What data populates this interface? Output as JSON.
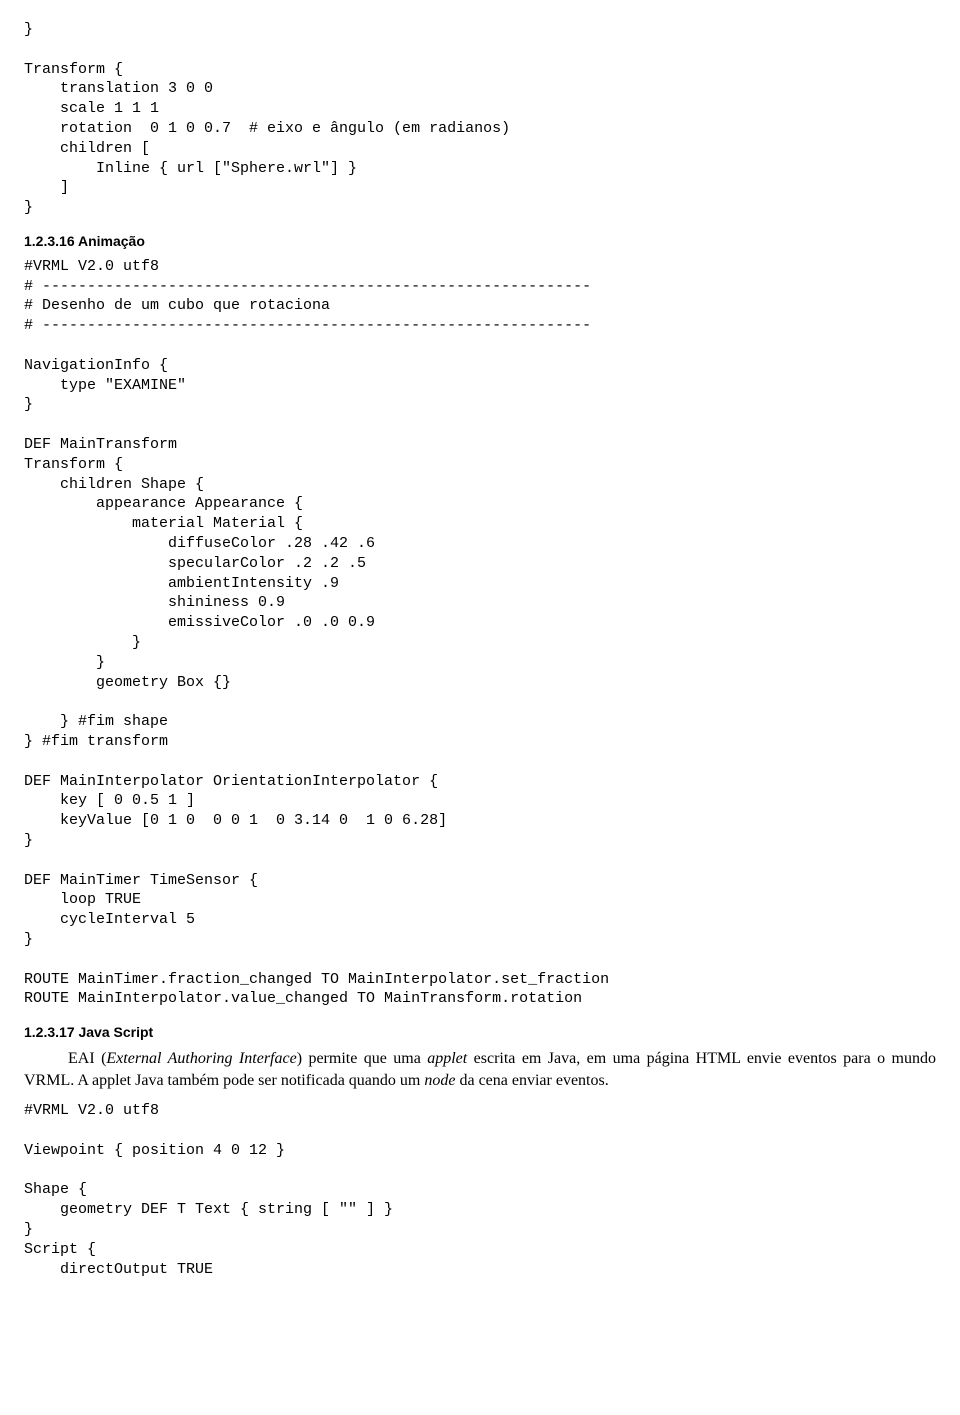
{
  "code_block_1": "}\n\nTransform {\n    translation 3 0 0\n    scale 1 1 1\n    rotation  0 1 0 0.7  # eixo e ângulo (em radianos)\n    children [\n        Inline { url [\"Sphere.wrl\"] }\n    ]\n}",
  "heading_1": "1.2.3.16  Animação",
  "code_block_2": "#VRML V2.0 utf8\n# -------------------------------------------------------------\n# Desenho de um cubo que rotaciona\n# -------------------------------------------------------------\n\nNavigationInfo {\n    type \"EXAMINE\"\n}\n\nDEF MainTransform\nTransform {\n    children Shape {\n        appearance Appearance {\n            material Material {\n                diffuseColor .28 .42 .6\n                specularColor .2 .2 .5\n                ambientIntensity .9\n                shininess 0.9\n                emissiveColor .0 .0 0.9\n            }\n        }\n        geometry Box {}\n\n    } #fim shape\n} #fim transform\n\nDEF MainInterpolator OrientationInterpolator {\n    key [ 0 0.5 1 ]\n    keyValue [0 1 0  0 0 1  0 3.14 0  1 0 6.28]\n}\n\nDEF MainTimer TimeSensor {\n    loop TRUE\n    cycleInterval 5\n}\n\nROUTE MainTimer.fraction_changed TO MainInterpolator.set_fraction\nROUTE MainInterpolator.value_changed TO MainTransform.rotation",
  "heading_2": "1.2.3.17  Java Script",
  "paragraph_1_a": "EAI (",
  "paragraph_1_b": "External Authoring Interface",
  "paragraph_1_c": ") permite que uma ",
  "paragraph_1_d": "applet",
  "paragraph_1_e": " escrita em Java, em uma página HTML envie eventos para o mundo VRML. A applet Java também pode ser notificada quando um ",
  "paragraph_1_f": "node",
  "paragraph_1_g": " da cena enviar eventos.",
  "code_block_3": "#VRML V2.0 utf8\n\nViewpoint { position 4 0 12 }\n\nShape {\n    geometry DEF T Text { string [ \"\" ] }\n}\nScript {\n    directOutput TRUE"
}
